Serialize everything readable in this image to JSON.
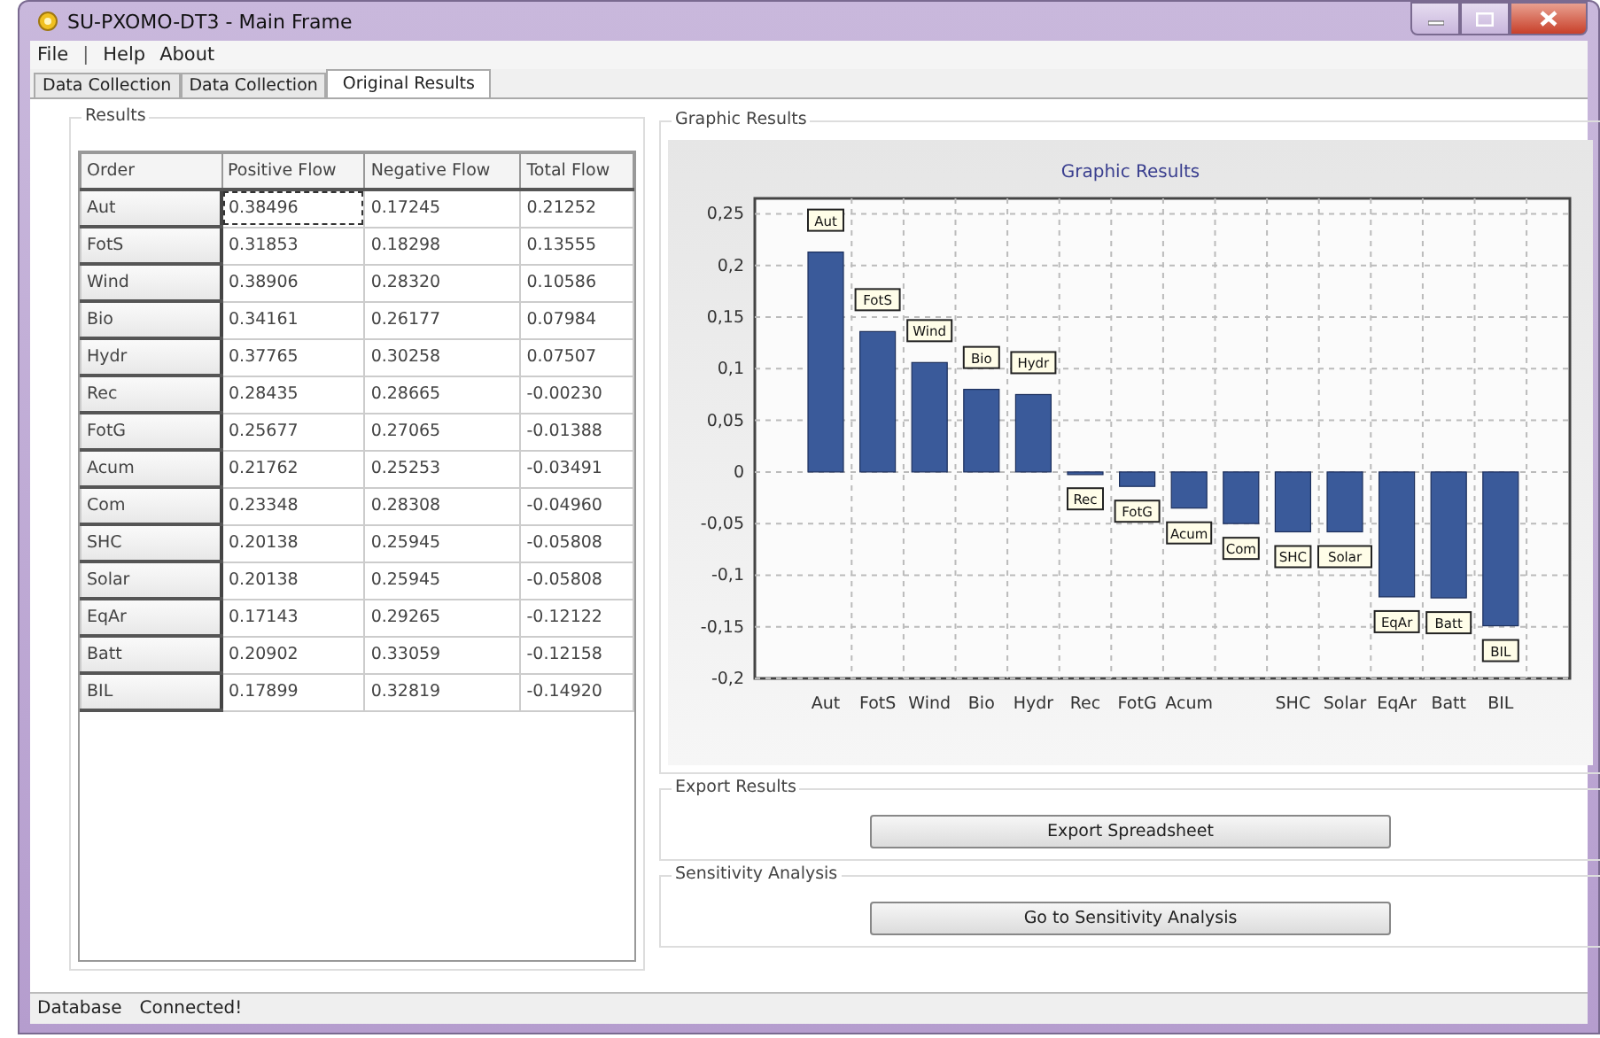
{
  "window": {
    "title": "SU-PXOMO-DT3 - Main Frame"
  },
  "menu": [
    {
      "label": "File",
      "kind": "item"
    },
    {
      "label": "|",
      "kind": "separator"
    },
    {
      "label": "Help",
      "kind": "item"
    },
    {
      "label": "About",
      "kind": "item"
    }
  ],
  "tabs": [
    {
      "label": "Data Collection",
      "selected": false
    },
    {
      "label": "Data Collection",
      "selected": false
    },
    {
      "label": "Original Results",
      "selected": true
    }
  ],
  "results": {
    "title": "Results",
    "table": {
      "columns": [
        "Order",
        "Positive Flow",
        "Negative Flow",
        "Total Flow"
      ],
      "rows": [
        {
          "order": "Aut",
          "positive": "0.38496",
          "negative": "0.17245",
          "total": "0.21252",
          "focused": true
        },
        {
          "order": "FotS",
          "positive": "0.31853",
          "negative": "0.18298",
          "total": "0.13555",
          "focused": false
        },
        {
          "order": "Wind",
          "positive": "0.38906",
          "negative": "0.28320",
          "total": "0.10586",
          "focused": false
        },
        {
          "order": "Bio",
          "positive": "0.34161",
          "negative": "0.26177",
          "total": "0.07984",
          "focused": false
        },
        {
          "order": "Hydr",
          "positive": "0.37765",
          "negative": "0.30258",
          "total": "0.07507",
          "focused": false
        },
        {
          "order": "Rec",
          "positive": "0.28435",
          "negative": "0.28665",
          "total": "-0.00230",
          "focused": false
        },
        {
          "order": "FotG",
          "positive": "0.25677",
          "negative": "0.27065",
          "total": "-0.01388",
          "focused": false
        },
        {
          "order": "Acum",
          "positive": "0.21762",
          "negative": "0.25253",
          "total": "-0.03491",
          "focused": false
        },
        {
          "order": "Com",
          "positive": "0.23348",
          "negative": "0.28308",
          "total": "-0.04960",
          "focused": false
        },
        {
          "order": "SHC",
          "positive": "0.20138",
          "negative": "0.25945",
          "total": "-0.05808",
          "focused": false
        },
        {
          "order": "Solar",
          "positive": "0.20138",
          "negative": "0.25945",
          "total": "-0.05808",
          "focused": false
        },
        {
          "order": "EqAr",
          "positive": "0.17143",
          "negative": "0.29265",
          "total": "-0.12122",
          "focused": false
        },
        {
          "order": "Batt",
          "positive": "0.20902",
          "negative": "0.33059",
          "total": "-0.12158",
          "focused": false
        },
        {
          "order": "BIL",
          "positive": "0.17899",
          "negative": "0.32819",
          "total": "-0.14920",
          "focused": false
        }
      ]
    }
  },
  "graphic_results": {
    "title": "Graphic Results",
    "chart_data": {
      "type": "bar",
      "title": "Graphic Results",
      "categories": [
        "Aut",
        "FotS",
        "Wind",
        "Bio",
        "Hydr",
        "Rec",
        "FotG",
        "Acum",
        null,
        "SHC",
        "Solar",
        "EqAr",
        "Batt",
        "BIL"
      ],
      "grid": true,
      "series": [
        {
          "color": "#3a5a9a",
          "values": [
            0.213,
            0.136,
            0.106,
            0.08,
            0.075,
            -0.002,
            -0.014,
            -0.035,
            -0.05,
            -0.058,
            -0.058,
            -0.121,
            -0.122,
            -0.149
          ]
        }
      ],
      "ylim": [
        -0.2,
        0.265
      ],
      "yticks": [
        {
          "value": 0.25,
          "label": "0,25"
        },
        {
          "value": 0.2,
          "label": "0,2"
        },
        {
          "value": 0.15,
          "label": "0,15"
        },
        {
          "value": 0.1,
          "label": "0,1"
        },
        {
          "value": 0.05,
          "label": "0,05"
        },
        {
          "value": 0,
          "label": "0"
        },
        {
          "value": -0.05,
          "label": "-0,05"
        },
        {
          "value": -0.1,
          "label": "-0,1"
        },
        {
          "value": -0.15,
          "label": "-0,15"
        },
        {
          "value": -0.2,
          "label": "-0,2"
        }
      ],
      "annotations": [
        "Aut",
        "FotS",
        "Wind",
        "Bio",
        "Hydr",
        "Rec",
        "FotG",
        "Acum",
        "Com",
        "SHC",
        "Solar",
        "EqAr",
        "Batt",
        "BIL"
      ]
    }
  },
  "export_results": {
    "title": "Export Results",
    "button": "Export Spreadsheet"
  },
  "sensitivity_analysis": {
    "title": "Sensitivity Analysis",
    "button": "Go to Sensitivity Analysis"
  },
  "status_bar": {
    "label": "Database",
    "value": "Connected!"
  }
}
